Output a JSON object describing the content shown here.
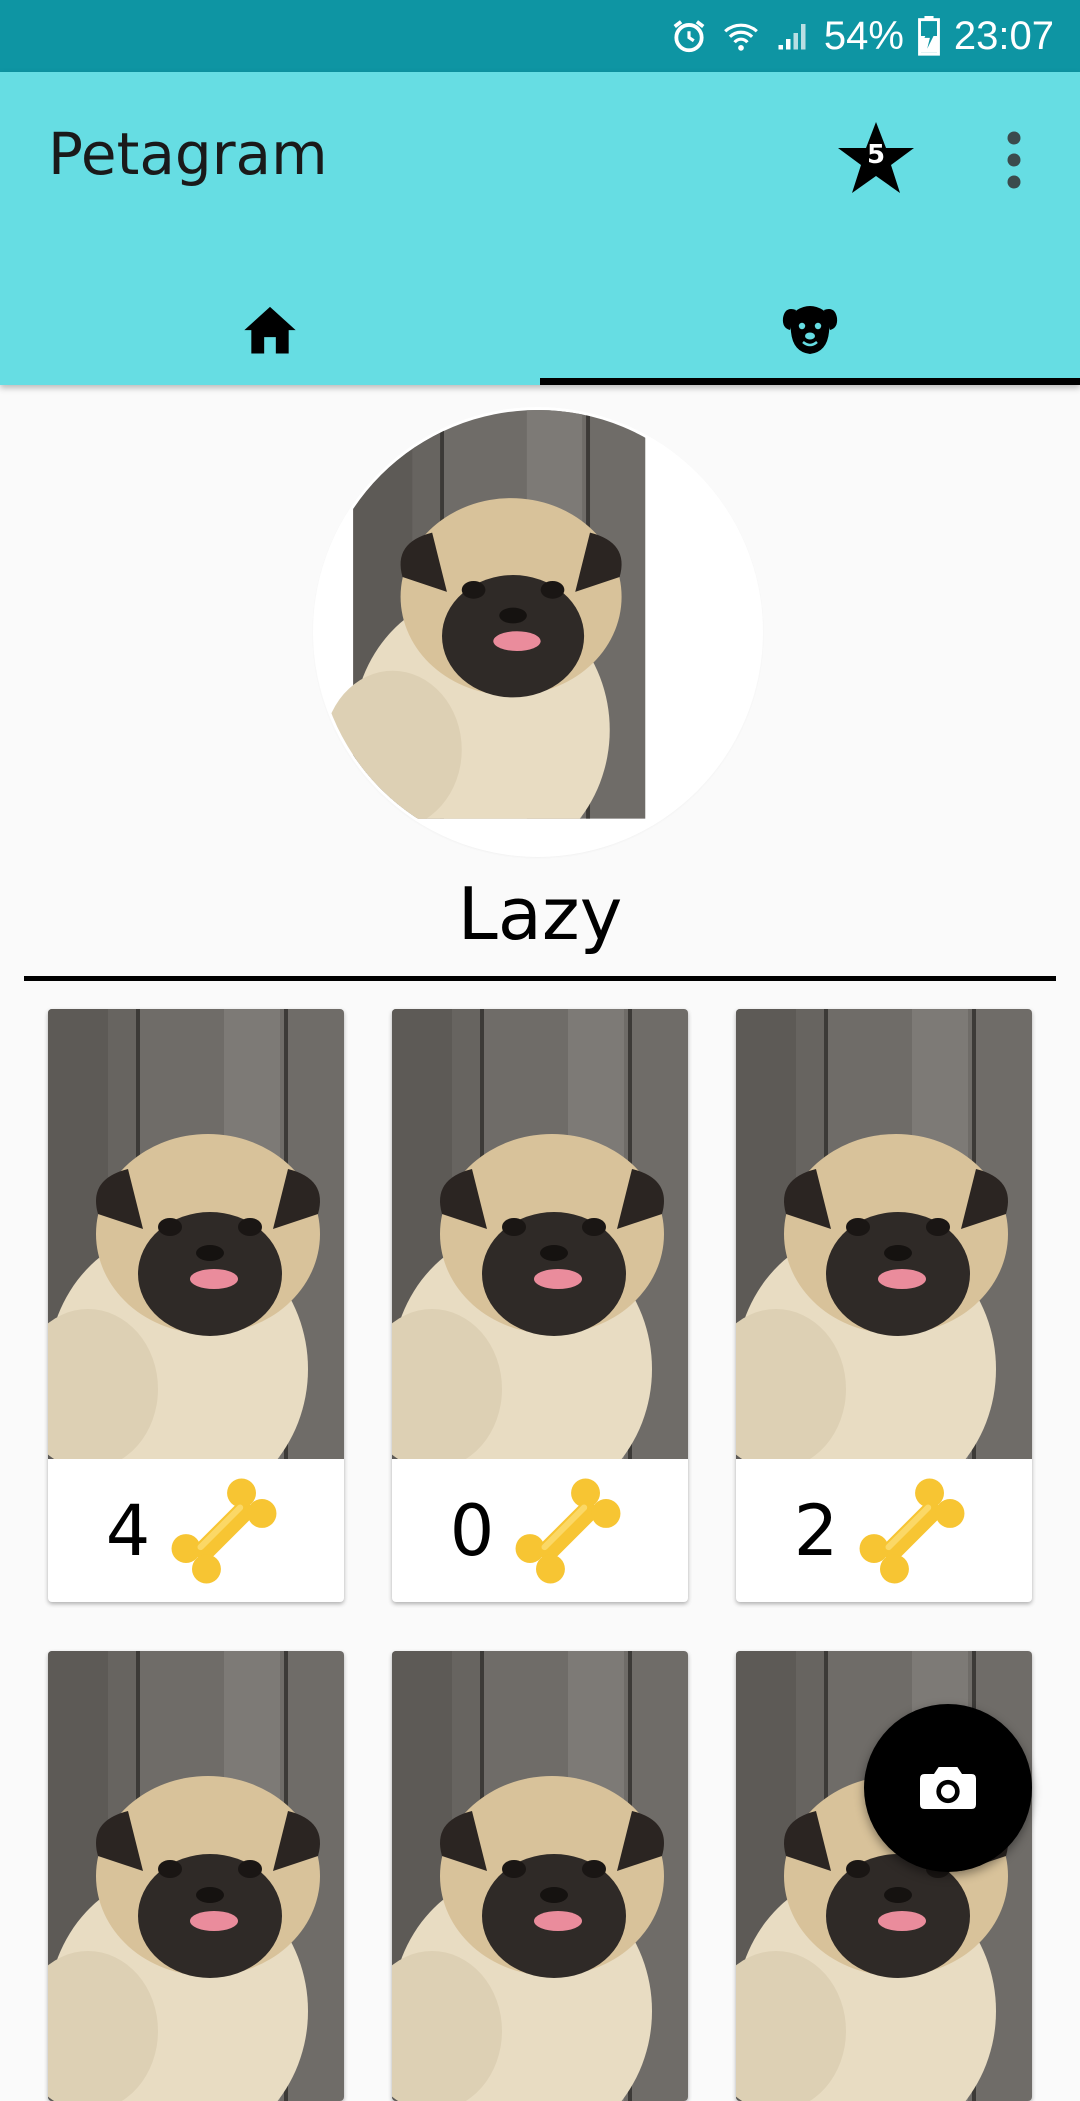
{
  "status_bar": {
    "battery": "54%",
    "time": "23:07"
  },
  "app_bar": {
    "title": "Petagram",
    "favorites_count": "5"
  },
  "tabs": [
    {
      "icon": "home-icon",
      "selected": false
    },
    {
      "icon": "dog-icon",
      "selected": true
    }
  ],
  "profile": {
    "name": "Lazy"
  },
  "grid": [
    {
      "likes": "4"
    },
    {
      "likes": "0"
    },
    {
      "likes": "2"
    },
    {
      "likes": ""
    },
    {
      "likes": ""
    },
    {
      "likes": ""
    }
  ],
  "fab": {
    "icon": "camera-icon"
  },
  "colors": {
    "status_bar": "#0e95a3",
    "app_bar": "#66dde3",
    "bone": "#f7c533",
    "fab": "#000000"
  }
}
